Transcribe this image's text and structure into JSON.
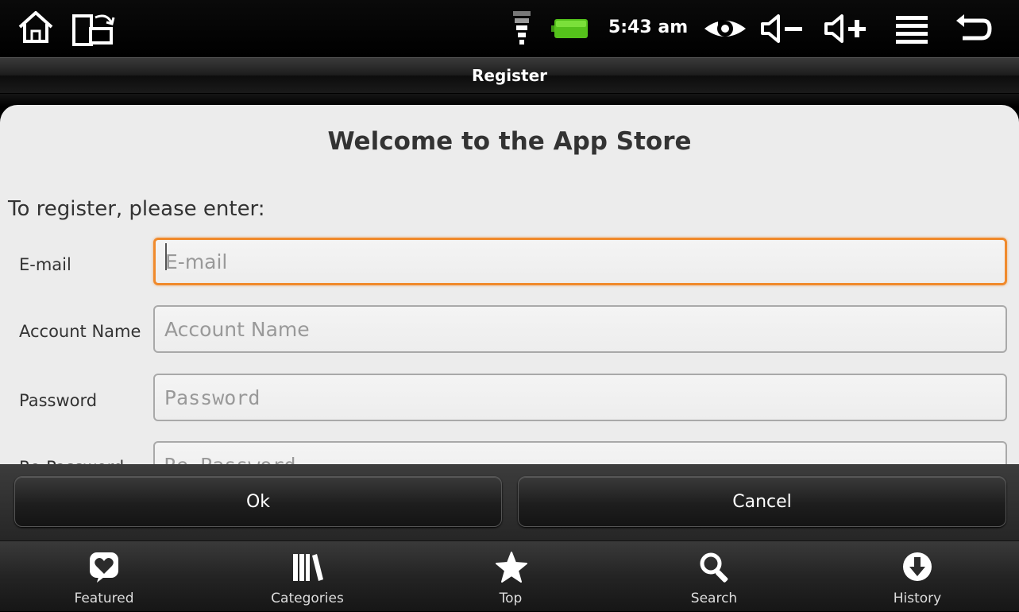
{
  "status_bar": {
    "time": "5:43 am",
    "icons": [
      "home-icon",
      "screen-rotate-icon",
      "wifi-icon",
      "battery-icon",
      "eye-icon",
      "volume-down-icon",
      "volume-up-icon",
      "menu-icon",
      "back-icon"
    ]
  },
  "title_bar": {
    "title": "Register"
  },
  "form": {
    "welcome": "Welcome to the App Store",
    "instruction": "To register, please enter:",
    "fields": [
      {
        "label": "E-mail",
        "placeholder": "E-mail",
        "value": ""
      },
      {
        "label": "Account Name",
        "placeholder": "Account Name",
        "value": ""
      },
      {
        "label": "Password",
        "placeholder": "Password",
        "value": ""
      },
      {
        "label": "Re-Password",
        "placeholder": "Re-Password",
        "value": ""
      }
    ]
  },
  "buttons": {
    "ok": "Ok",
    "cancel": "Cancel"
  },
  "tabs": [
    {
      "label": "Featured",
      "icon": "heart-icon"
    },
    {
      "label": "Categories",
      "icon": "books-icon"
    },
    {
      "label": "Top",
      "icon": "star-icon"
    },
    {
      "label": "Search",
      "icon": "search-icon"
    },
    {
      "label": "History",
      "icon": "download-icon"
    }
  ],
  "colors": {
    "focus": "#f08a2c",
    "panel": "#ececec",
    "bar": "#262626"
  }
}
